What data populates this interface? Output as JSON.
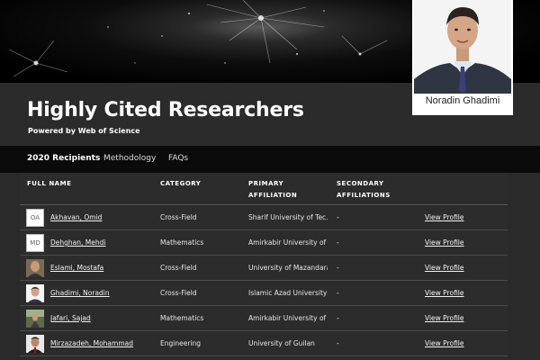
{
  "header": {
    "title": "Highly Cited Researchers",
    "powered_by": "Powered by Web of Science"
  },
  "featured": {
    "name": "Noradin Ghadimi"
  },
  "nav": {
    "items": [
      {
        "label": "2020 Recipients",
        "active": true
      },
      {
        "label": "Methodology",
        "active": false
      },
      {
        "label": "FAQs",
        "active": false
      }
    ]
  },
  "table": {
    "columns": [
      "FULL NAME",
      "CATEGORY",
      "PRIMARY\nAFFILIATION",
      "SECONDARY\nAFFILIATIONS",
      ""
    ],
    "rows": [
      {
        "avatar": "OA",
        "avatar_type": "initials",
        "name": "Akhavan, Omid",
        "category": "Cross-Field",
        "primary": "Sharif University of Tec...",
        "secondary": "-",
        "action": "View Profile"
      },
      {
        "avatar": "MD",
        "avatar_type": "initials",
        "name": "Dehghan, Mehdi",
        "category": "Mathematics",
        "primary": "Amirkabir University of ...",
        "secondary": "-",
        "action": "View Profile"
      },
      {
        "avatar": "",
        "avatar_type": "photo",
        "name": "Eslami, Mostafa",
        "category": "Cross-Field",
        "primary": "University of Mazandaran",
        "secondary": "-",
        "action": "View Profile"
      },
      {
        "avatar": "",
        "avatar_type": "photo",
        "name": "Ghadimi, Noradin",
        "category": "Cross-Field",
        "primary": "Islamic Azad University",
        "secondary": "-",
        "action": "View Profile"
      },
      {
        "avatar": "",
        "avatar_type": "photo",
        "name": "Jafari, Sajad",
        "category": "Mathematics",
        "primary": "Amirkabir University of ...",
        "secondary": "-",
        "action": "View Profile"
      },
      {
        "avatar": "",
        "avatar_type": "photo",
        "name": "Mirzazadeh, Mohammad",
        "category": "Engineering",
        "primary": "University of Guilan",
        "secondary": "-",
        "action": "View Profile"
      }
    ]
  },
  "colors": {
    "background": "#2a2a2a",
    "nav_background": "#0b0b0b",
    "text": "#ffffff"
  }
}
